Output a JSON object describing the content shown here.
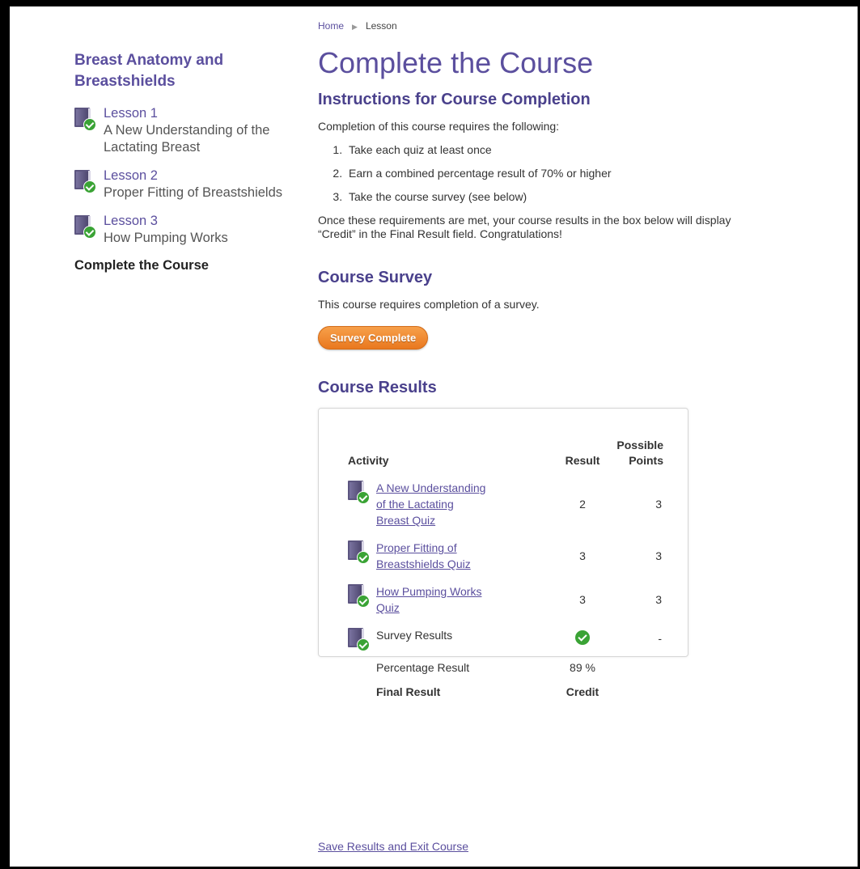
{
  "breadcrumb": {
    "home": "Home",
    "separator": "▶",
    "current": "Lesson"
  },
  "sidebar": {
    "title": "Breast Anatomy and Breastshields",
    "lessons": [
      {
        "number": "Lesson 1",
        "name": "A New Understanding of the Lactating Breast",
        "icon": "book-check-icon"
      },
      {
        "number": "Lesson 2",
        "name": "Proper Fitting of Breastshields",
        "icon": "book-check-icon"
      },
      {
        "number": "Lesson 3",
        "name": "How Pumping Works",
        "icon": "book-check-icon"
      }
    ],
    "current": "Complete the Course"
  },
  "main": {
    "title": "Complete the Course",
    "instructions": {
      "heading": "Instructions for Course Completion",
      "intro": "Completion of this course requires the following:",
      "requirements": [
        "Take each quiz at least once",
        "Earn a combined percentage result of 70% or higher",
        "Take the course survey (see below)"
      ],
      "outro": "Once these requirements are met, your course results in the box below will display “Credit” in the Final Result field. Congratulations!"
    },
    "survey": {
      "heading": "Course Survey",
      "description": "This course requires completion of a survey.",
      "button_label": "Survey Complete"
    },
    "results": {
      "heading": "Course Results",
      "columns": {
        "activity": "Activity",
        "result": "Result",
        "points": "Possible Points"
      },
      "rows": [
        {
          "activity": "A New Understanding of the Lactating Breast Quiz",
          "result": "2",
          "points": "3"
        },
        {
          "activity": "Proper Fitting of Breastshields Quiz",
          "result": "3",
          "points": "3"
        },
        {
          "activity": "How Pumping Works Quiz",
          "result": "3",
          "points": "3"
        }
      ],
      "survey_row": {
        "activity": "Survey Results",
        "result_icon": "check-circle-icon",
        "points": "-"
      },
      "percentage": {
        "label": "Percentage Result",
        "value": "89 %"
      },
      "final": {
        "label": "Final Result",
        "value": "Credit"
      }
    },
    "save_link": "Save Results and Exit Course"
  },
  "colors": {
    "brand_purple": "#5b4f9e",
    "button_orange": "#ee8a2e",
    "check_green": "#3aa335"
  }
}
